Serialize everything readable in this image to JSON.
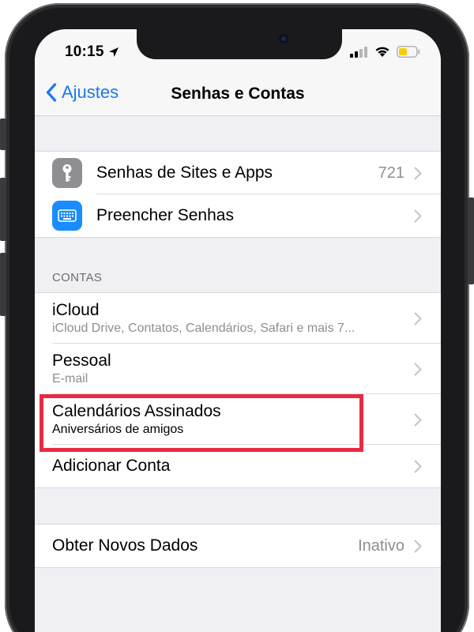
{
  "status_bar": {
    "time": "10:15"
  },
  "nav": {
    "back_label": "Ajustes",
    "title": "Senhas e Contas"
  },
  "passwords_group": {
    "items": [
      {
        "label": "Senhas de Sites e Apps",
        "value": "721",
        "icon": "key-icon",
        "icon_color": "#8e8e93"
      },
      {
        "label": "Preencher Senhas",
        "icon": "keyboard-icon",
        "icon_color": "#1a8cff"
      }
    ]
  },
  "accounts": {
    "header": "CONTAS",
    "items": [
      {
        "title": "iCloud",
        "subtitle": "iCloud Drive, Contatos, Calendários, Safari e mais 7..."
      },
      {
        "title": "Pessoal",
        "subtitle": "E-mail"
      },
      {
        "title": "Calendários Assinados",
        "subtitle": "Aniversários de amigos"
      },
      {
        "title": "Adicionar Conta"
      }
    ]
  },
  "fetch_group": {
    "label": "Obter Novos Dados",
    "value": "Inativo"
  },
  "colors": {
    "accent": "#1a78f2",
    "highlight": "#ea2a44",
    "background": "#efeff4"
  }
}
